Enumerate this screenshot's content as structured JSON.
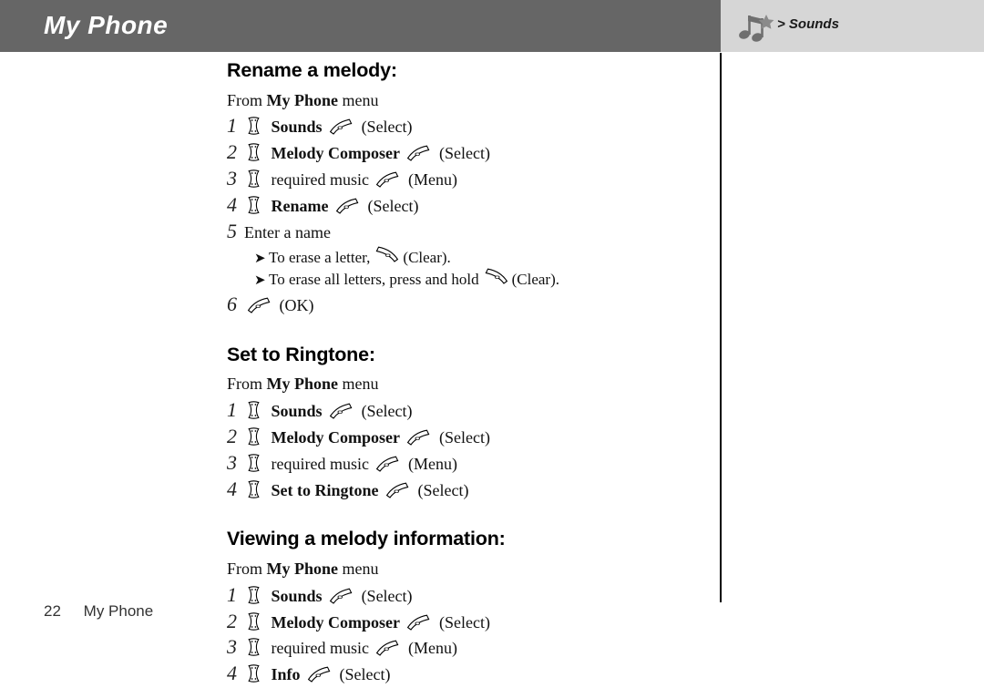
{
  "header": {
    "title": "My Phone",
    "breadcrumb": "> Sounds",
    "icon": "music-note-icon",
    "bar_color": "#666666",
    "panel_color": "#d6d6d6"
  },
  "icons": {
    "nav_key": "navigation-key-icon",
    "soft_key_left": "left-soft-key-icon",
    "soft_key_right": "right-soft-key-icon",
    "bullet": "arrow-bullet-icon"
  },
  "sections": [
    {
      "id": "rename",
      "title": "Rename a melody:",
      "from_prefix": "From",
      "from_bold": "My Phone",
      "from_suffix": "menu",
      "steps": [
        {
          "num": "1",
          "icon": "nav",
          "label": "Sounds",
          "bold": true,
          "key": "soft",
          "paren": "(Select)"
        },
        {
          "num": "2",
          "icon": "nav",
          "label": "Melody Composer",
          "bold": true,
          "key": "soft",
          "paren": "(Select)"
        },
        {
          "num": "3",
          "icon": "nav",
          "label": "required music",
          "bold": false,
          "key": "soft",
          "paren": "(Menu)"
        },
        {
          "num": "4",
          "icon": "nav",
          "label": "Rename",
          "bold": true,
          "key": "soft",
          "paren": "(Select)"
        },
        {
          "num": "5",
          "icon": "none",
          "label": "Enter a name",
          "bold": false,
          "key": "none",
          "paren": ""
        },
        {
          "num": "6",
          "icon": "none",
          "label": "",
          "bold": false,
          "key": "soft",
          "paren": "(OK)"
        }
      ],
      "subbullets": [
        {
          "after_step": "5",
          "bullet": "➤",
          "text_before": "To erase a letter,",
          "key": "soft-r",
          "text_after": "(Clear)."
        },
        {
          "after_step": "5",
          "bullet": "➤",
          "text_before": "To erase all letters, press and hold",
          "key": "soft-r",
          "text_after": "(Clear)."
        }
      ]
    },
    {
      "id": "ringtone",
      "title": "Set to Ringtone:",
      "from_prefix": "From",
      "from_bold": "My Phone",
      "from_suffix": "menu",
      "steps": [
        {
          "num": "1",
          "icon": "nav",
          "label": "Sounds",
          "bold": true,
          "key": "soft",
          "paren": "(Select)"
        },
        {
          "num": "2",
          "icon": "nav",
          "label": "Melody Composer",
          "bold": true,
          "key": "soft",
          "paren": "(Select)"
        },
        {
          "num": "3",
          "icon": "nav",
          "label": "required music",
          "bold": false,
          "key": "soft",
          "paren": "(Menu)"
        },
        {
          "num": "4",
          "icon": "nav",
          "label": "Set to Ringtone",
          "bold": true,
          "key": "soft",
          "paren": "(Select)"
        }
      ],
      "subbullets": []
    },
    {
      "id": "viewing",
      "title": "Viewing a melody information:",
      "from_prefix": "From",
      "from_bold": "My Phone",
      "from_suffix": "menu",
      "steps": [
        {
          "num": "1",
          "icon": "nav",
          "label": "Sounds",
          "bold": true,
          "key": "soft",
          "paren": "(Select)"
        },
        {
          "num": "2",
          "icon": "nav",
          "label": "Melody Composer",
          "bold": true,
          "key": "soft",
          "paren": "(Select)"
        },
        {
          "num": "3",
          "icon": "nav",
          "label": "required music",
          "bold": false,
          "key": "soft",
          "paren": "(Menu)"
        },
        {
          "num": "4",
          "icon": "nav",
          "label": "Info",
          "bold": true,
          "key": "soft",
          "paren": "(Select)"
        }
      ],
      "subbullets": []
    }
  ],
  "footer": {
    "page_number": "22",
    "label": "My Phone"
  }
}
